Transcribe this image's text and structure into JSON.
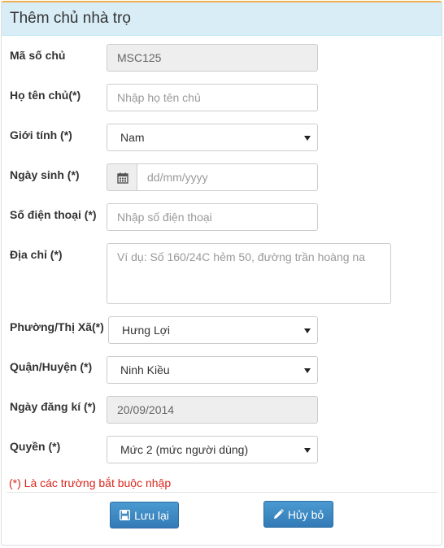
{
  "header": {
    "title": "Thêm chủ nhà trọ"
  },
  "fields": {
    "owner_id": {
      "label": "Mã số chủ",
      "value": "MSC125"
    },
    "full_name": {
      "label": "Họ tên chủ(*)",
      "placeholder": "Nhập họ tên chủ"
    },
    "gender": {
      "label": "Giới tính (*)",
      "selected": "Nam"
    },
    "birth_date": {
      "label": "Ngày sinh (*)",
      "placeholder": "dd/mm/yyyy"
    },
    "phone": {
      "label": "Số điện thoại (*)",
      "placeholder": "Nhập số điện thoại"
    },
    "address": {
      "label": "Địa chỉ (*)",
      "placeholder": "Ví dụ: Số 160/24C hẻm 50, đường trần hoàng na"
    },
    "ward": {
      "label": "Phường/Thị Xã(*)",
      "selected": "Hưng Lợi"
    },
    "district": {
      "label": "Quận/Huyện (*)",
      "selected": "Ninh Kiều"
    },
    "register_date": {
      "label": "Ngày đăng kí (*)",
      "value": "20/09/2014"
    },
    "role": {
      "label": "Quyền (*)",
      "selected": "Mức 2 (mức người dùng)"
    }
  },
  "note": "(*) Là các trường bắt buộc nhập",
  "buttons": {
    "save": "Lưu lại",
    "cancel": "Hủy bỏ"
  },
  "icons": {
    "date": "calendar-icon",
    "save": "floppy-disk-icon",
    "cancel": "pencil-icon",
    "dropdown": "caret-down-icon"
  },
  "colors": {
    "heading_bg": "#d9edf7",
    "button": "#337ab7",
    "required_note": "#d9261c",
    "top_accent": "#f0ad4e"
  }
}
